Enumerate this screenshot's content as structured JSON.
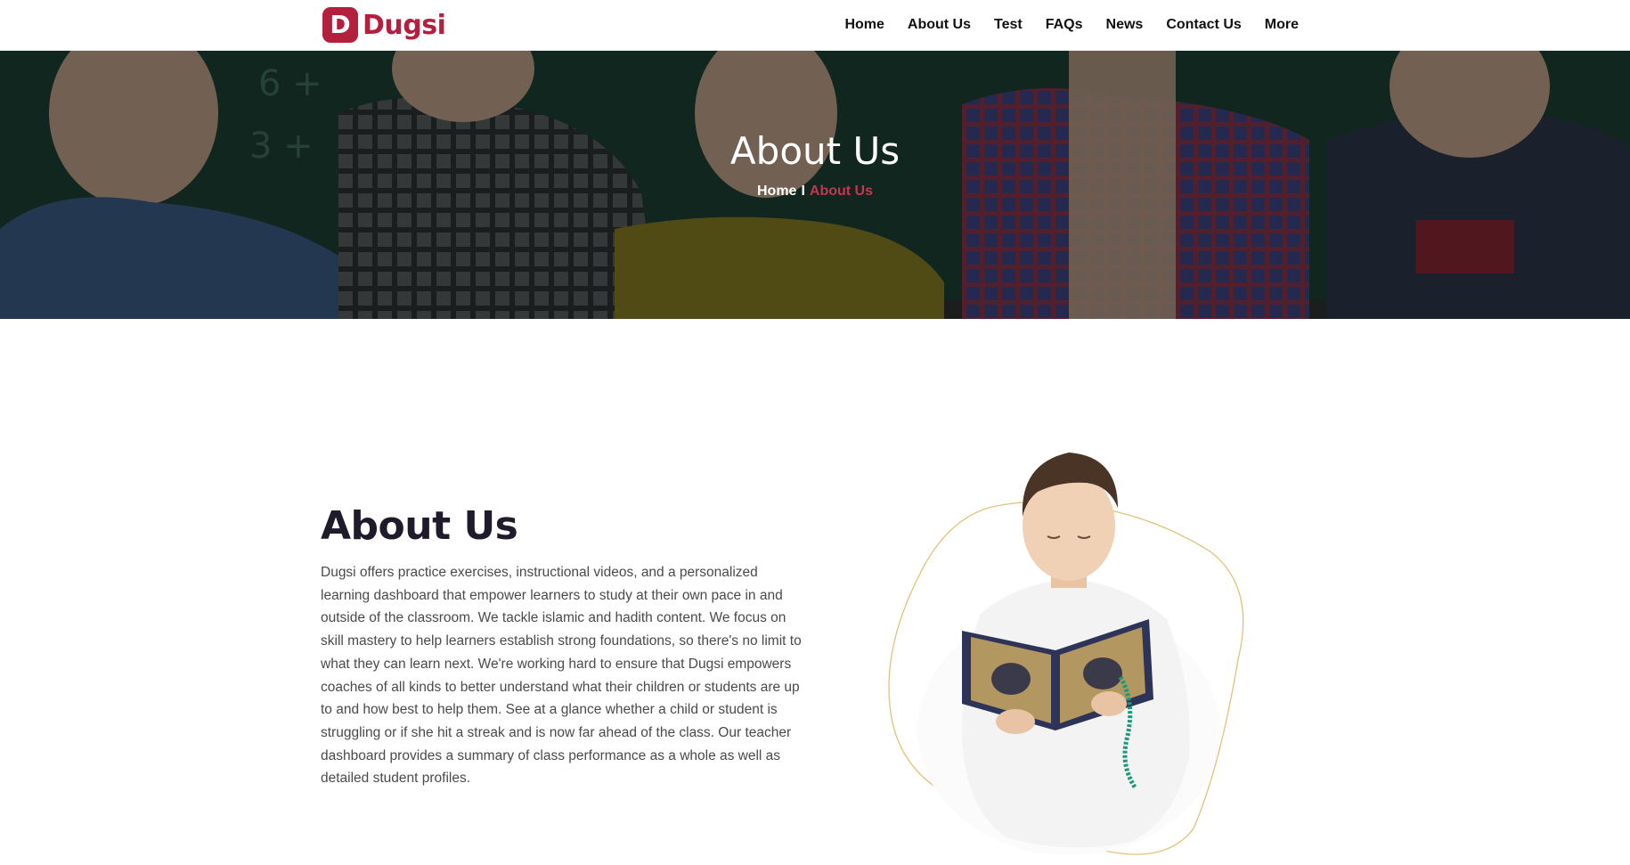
{
  "header": {
    "logo_text": "Dugsi",
    "logo_letter": "D",
    "nav": [
      "Home",
      "About Us",
      "Test",
      "FAQs",
      "News",
      "Contact Us",
      "More"
    ]
  },
  "hero": {
    "title": "About Us",
    "breadcrumb": {
      "home": "Home",
      "separator": "I",
      "current": "About Us"
    }
  },
  "about": {
    "heading": "About Us",
    "body": "Dugsi offers practice exercises, instructional videos, and a personalized learning dashboard that empower learners to study at their own pace in and outside of the classroom. We tackle islamic and hadith content. We focus on skill mastery to help learners establish strong foundations, so there's no limit to what they can learn next. We're working hard to ensure that Dugsi empowers coaches of all kinds to better understand what their children or students are up to and how best to help them. See at a glance whether a child or student is struggling or if she hit a streak and is now far ahead of the class. Our teacher dashboard provides a summary of class performance as a whole as well as detailed student profiles."
  },
  "colors": {
    "brand": "#b3203d",
    "breadcrumb_active": "#c8354f",
    "heading": "#1f1b2a"
  }
}
